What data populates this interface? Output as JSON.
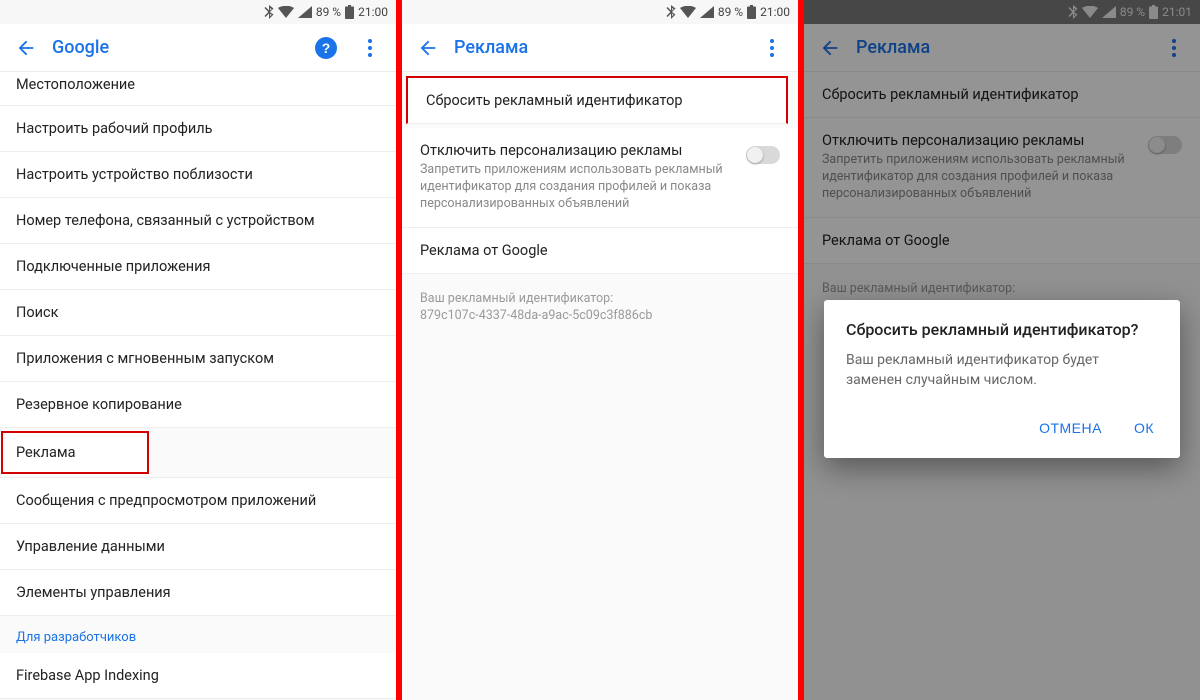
{
  "status": {
    "battery": "89 %",
    "time1": "21:00",
    "time2": "21:00",
    "time3": "21:01"
  },
  "screen1": {
    "title": "Google",
    "items": [
      "Местоположение",
      "Настроить рабочий профиль",
      "Настроить устройство поблизости",
      "Номер телефона, связанный с устройством",
      "Подключенные приложения",
      "Поиск",
      "Приложения с мгновенным запуском",
      "Резервное копирование",
      "Реклама",
      "Сообщения с предпросмотром приложений",
      "Управление данными",
      "Элементы управления"
    ],
    "sectionLabel": "Для разработчиков",
    "devItems": [
      "Firebase App Indexing"
    ]
  },
  "screen2": {
    "title": "Реклама",
    "resetAdId": "Сбросить рекламный идентификатор",
    "optOut": {
      "title": "Отключить персонализацию рекламы",
      "sub": "Запретить приложениям использовать рекламный идентификатор для создания профилей и показа персонализированных объявлений"
    },
    "adsByGoogle": "Реклама от Google",
    "footerLabel": "Ваш рекламный идентификатор:",
    "footerId": "879c107c-4337-48da-a9ac-5c09c3f886cb"
  },
  "screen3": {
    "title": "Реклама",
    "resetAdId": "Сбросить рекламный идентификатор",
    "optOut": {
      "title": "Отключить персонализацию рекламы",
      "sub": "Запретить приложениям использовать рекламный идентификатор для создания профилей и показа персонализированных объявлений"
    },
    "adsByGoogle": "Реклама от Google",
    "footerLabel": "Ваш рекламный идентификатор:",
    "dialog": {
      "title": "Сбросить рекламный идентификатор?",
      "message": "Ваш рекламный идентификатор будет заменен случайным числом.",
      "cancel": "ОТМЕНА",
      "ok": "ОК"
    }
  }
}
